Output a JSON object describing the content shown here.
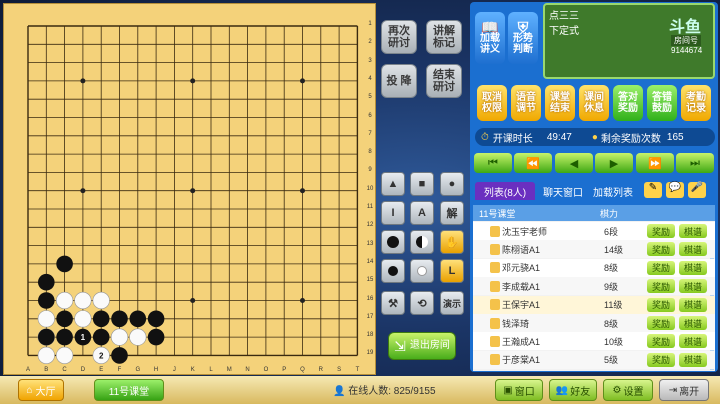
{
  "board": {
    "col_labels": [
      "A",
      "B",
      "C",
      "D",
      "E",
      "F",
      "G",
      "H",
      "J",
      "K",
      "L",
      "M",
      "N",
      "O",
      "P",
      "Q",
      "R",
      "S",
      "T"
    ],
    "row_labels": [
      "1",
      "2",
      "3",
      "4",
      "5",
      "6",
      "7",
      "8",
      "9",
      "10",
      "11",
      "12",
      "13",
      "14",
      "15",
      "16",
      "17",
      "18",
      "19"
    ],
    "move_numbers": [
      "1",
      "2"
    ]
  },
  "mid": {
    "review_again": "再次\n研讨",
    "explain_mark": "讲解\n标记",
    "resign": "投 降",
    "end_review": "结束\n研讨",
    "tool_text_I": "I",
    "tool_text_A": "A",
    "tool_explain": "解",
    "tool_show": "演示",
    "exit_room": "退出房间"
  },
  "top": {
    "lecture": "加载\n讲义",
    "judge": "形势\n判断",
    "move_text": "点三三",
    "move_sub": "下定式",
    "brand": "斗鱼",
    "room_label": "房间号",
    "room_id": "9144674"
  },
  "controls": {
    "undo": "取消\n权限",
    "mic": "语音\n调节",
    "end_class": "课堂\n结束",
    "break": "课间\n休息",
    "reward": "答对\n奖励",
    "encourage": "答错\n鼓励",
    "exam": "考勤\n记录"
  },
  "timer": {
    "label": "开课时长",
    "value": "49:47",
    "reward_label": "剩余奖励次数",
    "reward_value": "165"
  },
  "tabs": {
    "list": "列表(8人)",
    "chat": "聊天窗口",
    "load_list": "加载列表"
  },
  "table": {
    "col_class": "11号课堂",
    "col_level": "棋力",
    "reward": "奖励",
    "review": "棋谱",
    "rows": [
      {
        "name": "沈玉宇老师",
        "level": "6段"
      },
      {
        "name": "陈栩语A1",
        "level": "14级"
      },
      {
        "name": "邓元骁A1",
        "level": "8级"
      },
      {
        "name": "李成载A1",
        "level": "9级"
      },
      {
        "name": "王保宇A1",
        "level": "11级"
      },
      {
        "name": "钱泽琦",
        "level": "8级"
      },
      {
        "name": "王瀚成A1",
        "level": "10级"
      },
      {
        "name": "于彦棠A1",
        "level": "5级"
      }
    ]
  },
  "bottombar": {
    "hall": "大厅",
    "classroom": "11号课堂",
    "online_label": "在线人数:",
    "online_value": "825/9155",
    "window": "窗口",
    "friends": "好友",
    "settings": "设置",
    "leave": "离开"
  },
  "colors": {
    "board": "#f4d27a",
    "accent": "#1b6fd0",
    "green": "#7fbd23"
  }
}
